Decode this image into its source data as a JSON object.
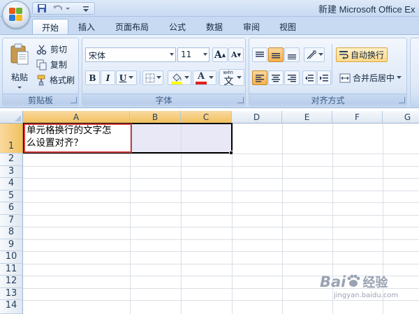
{
  "window": {
    "title": "新建 Microsoft Office Ex"
  },
  "tabs": [
    "开始",
    "插入",
    "页面布局",
    "公式",
    "数据",
    "审阅",
    "视图"
  ],
  "clipboard": {
    "paste_label": "粘贴",
    "cut_label": "剪切",
    "copy_label": "复制",
    "format_painter_label": "格式刷",
    "group_label": "剪贴板"
  },
  "font": {
    "family": "宋体",
    "size": "11",
    "bold": "B",
    "italic": "I",
    "underline": "U",
    "grow": "A",
    "shrink": "A",
    "font_color": "A",
    "phonetic_top": "wén",
    "phonetic": "文",
    "group_label": "字体"
  },
  "alignment": {
    "wrap_text_label": "自动换行",
    "merge_center_label": "合并后居中",
    "group_label": "对齐方式"
  },
  "sheet": {
    "columns": [
      "A",
      "B",
      "C",
      "D",
      "E",
      "F",
      "G"
    ],
    "rows": [
      "1",
      "2",
      "3",
      "4",
      "5",
      "6",
      "7",
      "8",
      "9",
      "10",
      "11",
      "12",
      "13",
      "14"
    ],
    "cell_a1_line1": "单元格换行的文字怎",
    "cell_a1_line2": "么设置对齐？"
  },
  "watermark": {
    "logo": "Bai",
    "logo2": "经验",
    "sub": "jingyan.baidu.com"
  },
  "colors": {
    "accent_orange": "#f1c15f",
    "ribbon_blue": "#dbe7f7",
    "active_cell_border": "#d43b3b",
    "font_color_bar": "#e02020",
    "highlight_yellow": "#ffff00"
  }
}
